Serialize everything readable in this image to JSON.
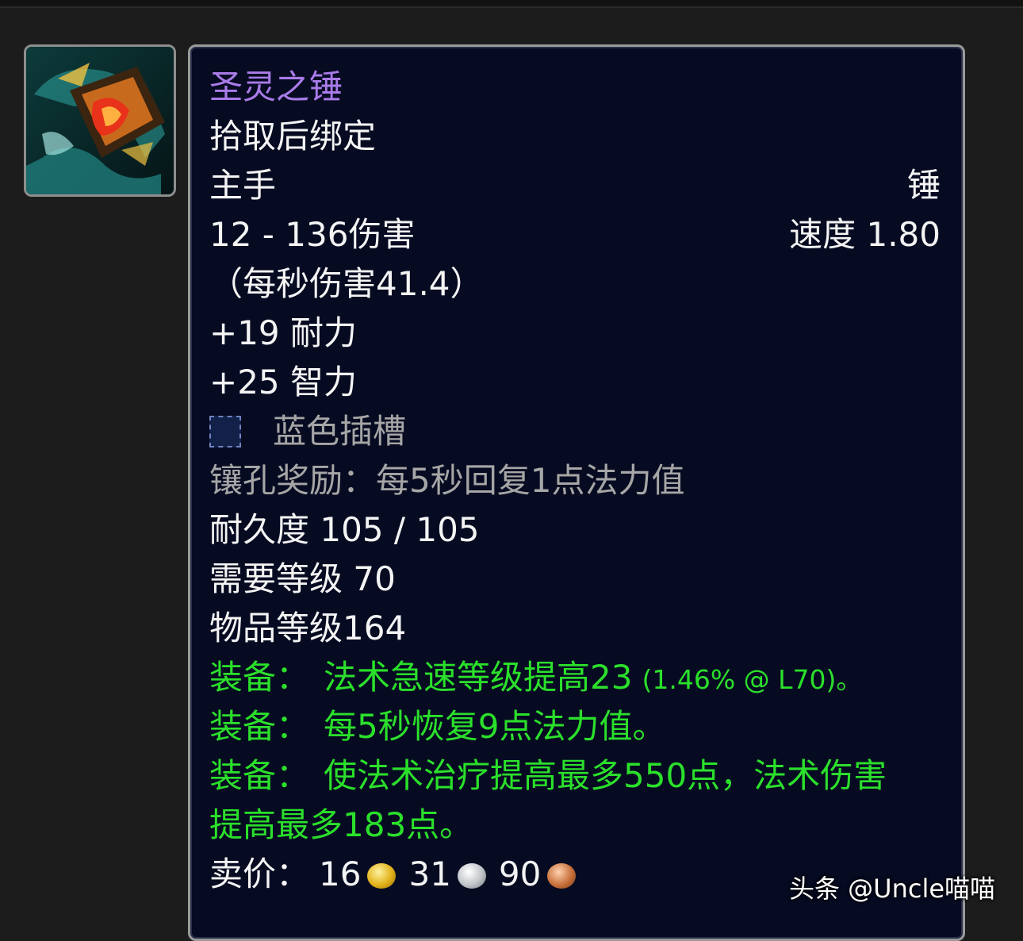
{
  "item": {
    "name": "圣灵之锤",
    "binding": "拾取后绑定",
    "slot": "主手",
    "type": "锤",
    "damage": "12 - 136伤害",
    "speed": "速度 1.80",
    "dps": "（每秒伤害41.4）",
    "stat_stamina": "+19 耐力",
    "stat_intellect": "+25 智力",
    "socket_label": "蓝色插槽",
    "socket_bonus": "镶孔奖励：每5秒回复1点法力值",
    "durability": "耐久度 105 / 105",
    "required_level": "需要等级 70",
    "item_level": "物品等级164",
    "equip1_label": "装备：",
    "equip1_text": "法术急速等级提高23",
    "equip1_note": "(1.46% @ L70)。",
    "equip2_label": "装备：",
    "equip2_text": "每5秒恢复9点法力值。",
    "equip3_label": "装备：",
    "equip3_text": "使法术治疗提高最多550点，法术伤害",
    "equip3_cont": "提高最多183点。",
    "sell_label": "卖价：",
    "sell_gold": "16",
    "sell_silver": "31",
    "sell_copper": "90"
  },
  "watermark": "头条 @Uncle喵喵",
  "colors": {
    "epic": "#a97be8",
    "equip_green": "#2be02b",
    "socket_gray": "#a6a6a6",
    "tooltip_bg": "#070b22"
  },
  "icons": {
    "item_icon": "hammer-icon",
    "socket_icon": "blue-socket-icon",
    "gold": "gold-coin-icon",
    "silver": "silver-coin-icon",
    "copper": "copper-coin-icon"
  }
}
